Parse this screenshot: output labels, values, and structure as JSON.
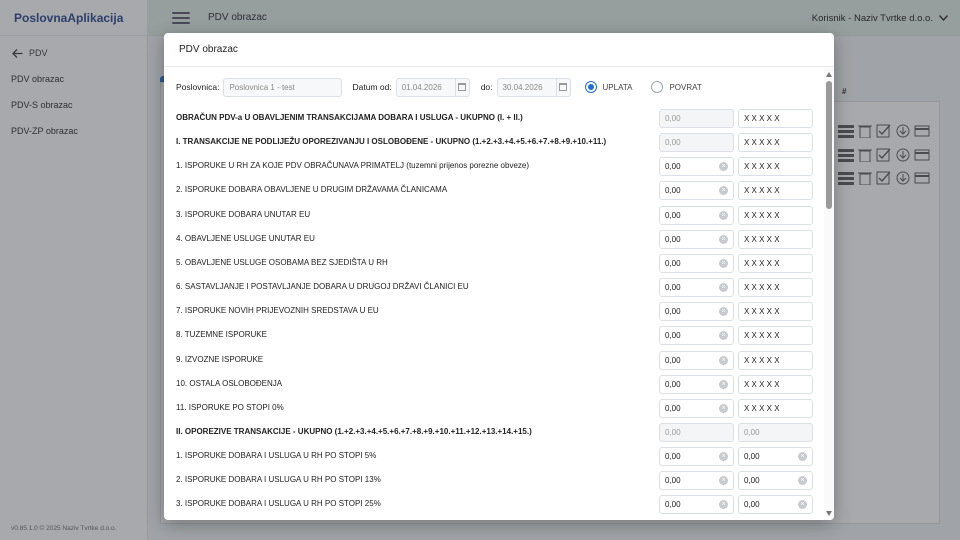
{
  "app": {
    "brand": "PoslovnaAplikacija",
    "version": "v0.85.1.0 © 2025 Naziv Tvrtke d.o.o."
  },
  "topbar": {
    "title": "PDV obrazac",
    "user": "Korisnik - Naziv Tvrtke d.o.o."
  },
  "sidebar": {
    "back_label": "PDV",
    "items": [
      {
        "label": "PDV obrazac"
      },
      {
        "label": "PDV-S obrazac"
      },
      {
        "label": "PDV-ZP obrazac"
      }
    ]
  },
  "background": {
    "table_header": "#"
  },
  "modal": {
    "title": "PDV obrazac",
    "filters": {
      "poslovnica_label": "Poslovnica:",
      "poslovnica_value": "Poslovnica 1 - test",
      "datum_od_label": "Datum od:",
      "datum_od_value": "01.04.2026",
      "do_label": "do:",
      "do_value": "30.04.2026",
      "uplata_label": "UPLATA",
      "povrat_label": "POVRAT",
      "selected": "UPLATA"
    },
    "rows": [
      {
        "label": "OBRAČUN PDV-a U OBAVLJENIM TRANSAKCIJAMA DOBARA I USLUGA - UKUPNO (I. + II.)",
        "bold": true,
        "a": "0,00",
        "b": "X X X X X",
        "a_dis": true,
        "b_dis": false,
        "a_clear": false,
        "b_clear": false
      },
      {
        "label": "I. TRANSAKCIJE NE PODLIJEŽU OPOREZIVANJU I OSLOBOĐENE - UKUPNO (1.+2.+3.+4.+5.+6.+7.+8.+9.+10.+11.)",
        "bold": true,
        "a": "0,00",
        "b": "X X X X X",
        "a_dis": true,
        "b_dis": false,
        "a_clear": false,
        "b_clear": false
      },
      {
        "label": "1. ISPORUKE U RH ZA KOJE PDV OBRAČUNAVA PRIMATELJ (tuzemni prijenos porezne obveze)",
        "bold": false,
        "a": "0,00",
        "b": "X X X X X",
        "a_dis": false,
        "b_dis": false,
        "a_clear": true,
        "b_clear": false
      },
      {
        "label": "2. ISPORUKE DOBARA OBAVLJENE U DRUGIM DRŽAVAMA ČLANICAMA",
        "bold": false,
        "a": "0,00",
        "b": "X X X X X",
        "a_dis": false,
        "b_dis": false,
        "a_clear": true,
        "b_clear": false
      },
      {
        "label": "3. ISPORUKE DOBARA UNUTAR EU",
        "bold": false,
        "a": "0,00",
        "b": "X X X X X",
        "a_dis": false,
        "b_dis": false,
        "a_clear": true,
        "b_clear": false
      },
      {
        "label": "4. OBAVLJENE USLUGE UNUTAR EU",
        "bold": false,
        "a": "0,00",
        "b": "X X X X X",
        "a_dis": false,
        "b_dis": false,
        "a_clear": true,
        "b_clear": false
      },
      {
        "label": "5. OBAVLJENE USLUGE OSOBAMA BEZ SJEDIŠTA U RH",
        "bold": false,
        "a": "0,00",
        "b": "X X X X X",
        "a_dis": false,
        "b_dis": false,
        "a_clear": true,
        "b_clear": false
      },
      {
        "label": "6. SASTAVLJANJE I POSTAVLJANJE DOBARA U DRUGOJ DRŽAVI ČLANICI EU",
        "bold": false,
        "a": "0,00",
        "b": "X X X X X",
        "a_dis": false,
        "b_dis": false,
        "a_clear": true,
        "b_clear": false
      },
      {
        "label": "7. ISPORUKE NOVIH PRIJEVOZNIH SREDSTAVA U EU",
        "bold": false,
        "a": "0,00",
        "b": "X X X X X",
        "a_dis": false,
        "b_dis": false,
        "a_clear": true,
        "b_clear": false
      },
      {
        "label": "8. TUZEMNE ISPORUKE",
        "bold": false,
        "a": "0,00",
        "b": "X X X X X",
        "a_dis": false,
        "b_dis": false,
        "a_clear": true,
        "b_clear": false
      },
      {
        "label": "9. IZVOZNE ISPORUKE",
        "bold": false,
        "a": "0,00",
        "b": "X X X X X",
        "a_dis": false,
        "b_dis": false,
        "a_clear": true,
        "b_clear": false
      },
      {
        "label": "10. OSTALA OSLOBOĐENJA",
        "bold": false,
        "a": "0,00",
        "b": "X X X X X",
        "a_dis": false,
        "b_dis": false,
        "a_clear": true,
        "b_clear": false
      },
      {
        "label": "11. ISPORUKE PO STOPI 0%",
        "bold": false,
        "a": "0,00",
        "b": "X X X X X",
        "a_dis": false,
        "b_dis": false,
        "a_clear": true,
        "b_clear": false
      },
      {
        "label": "II. OPOREZIVE TRANSAKCIJE - UKUPNO (1.+2.+3.+4.+5.+6.+7.+8.+9.+10.+11.+12.+13.+14.+15.)",
        "bold": true,
        "a": "0,00",
        "b": "0,00",
        "a_dis": true,
        "b_dis": true,
        "a_clear": false,
        "b_clear": false
      },
      {
        "label": "1. ISPORUKE DOBARA I USLUGA U RH PO STOPI 5%",
        "bold": false,
        "a": "0,00",
        "b": "0,00",
        "a_dis": false,
        "b_dis": false,
        "a_clear": true,
        "b_clear": true
      },
      {
        "label": "2. ISPORUKE DOBARA I USLUGA U RH PO STOPI 13%",
        "bold": false,
        "a": "0,00",
        "b": "0,00",
        "a_dis": false,
        "b_dis": false,
        "a_clear": true,
        "b_clear": true
      },
      {
        "label": "3. ISPORUKE DOBARA I USLUGA U RH PO STOPI 25%",
        "bold": false,
        "a": "0,00",
        "b": "0,00",
        "a_dis": false,
        "b_dis": false,
        "a_clear": true,
        "b_clear": true
      }
    ]
  }
}
